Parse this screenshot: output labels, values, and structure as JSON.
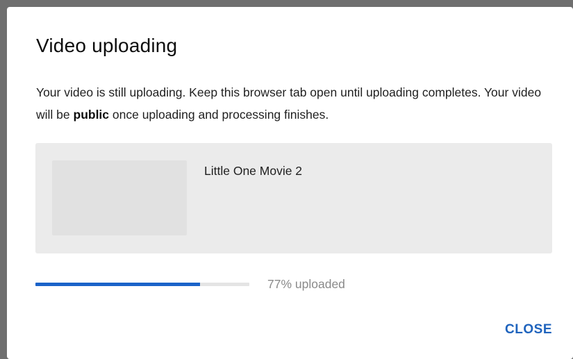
{
  "dialog": {
    "title": "Video uploading",
    "message_part1": "Your video is still uploading. Keep this browser tab open until uploading completes. Your video will be ",
    "message_emphasis": "public",
    "message_part2": " once uploading and processing finishes."
  },
  "video": {
    "title": "Little One Movie 2"
  },
  "upload": {
    "progress_fraction": 0.77,
    "progress_label": "77% uploaded",
    "progress_color": "#1a63c9"
  },
  "actions": {
    "close_label": "CLOSE"
  }
}
